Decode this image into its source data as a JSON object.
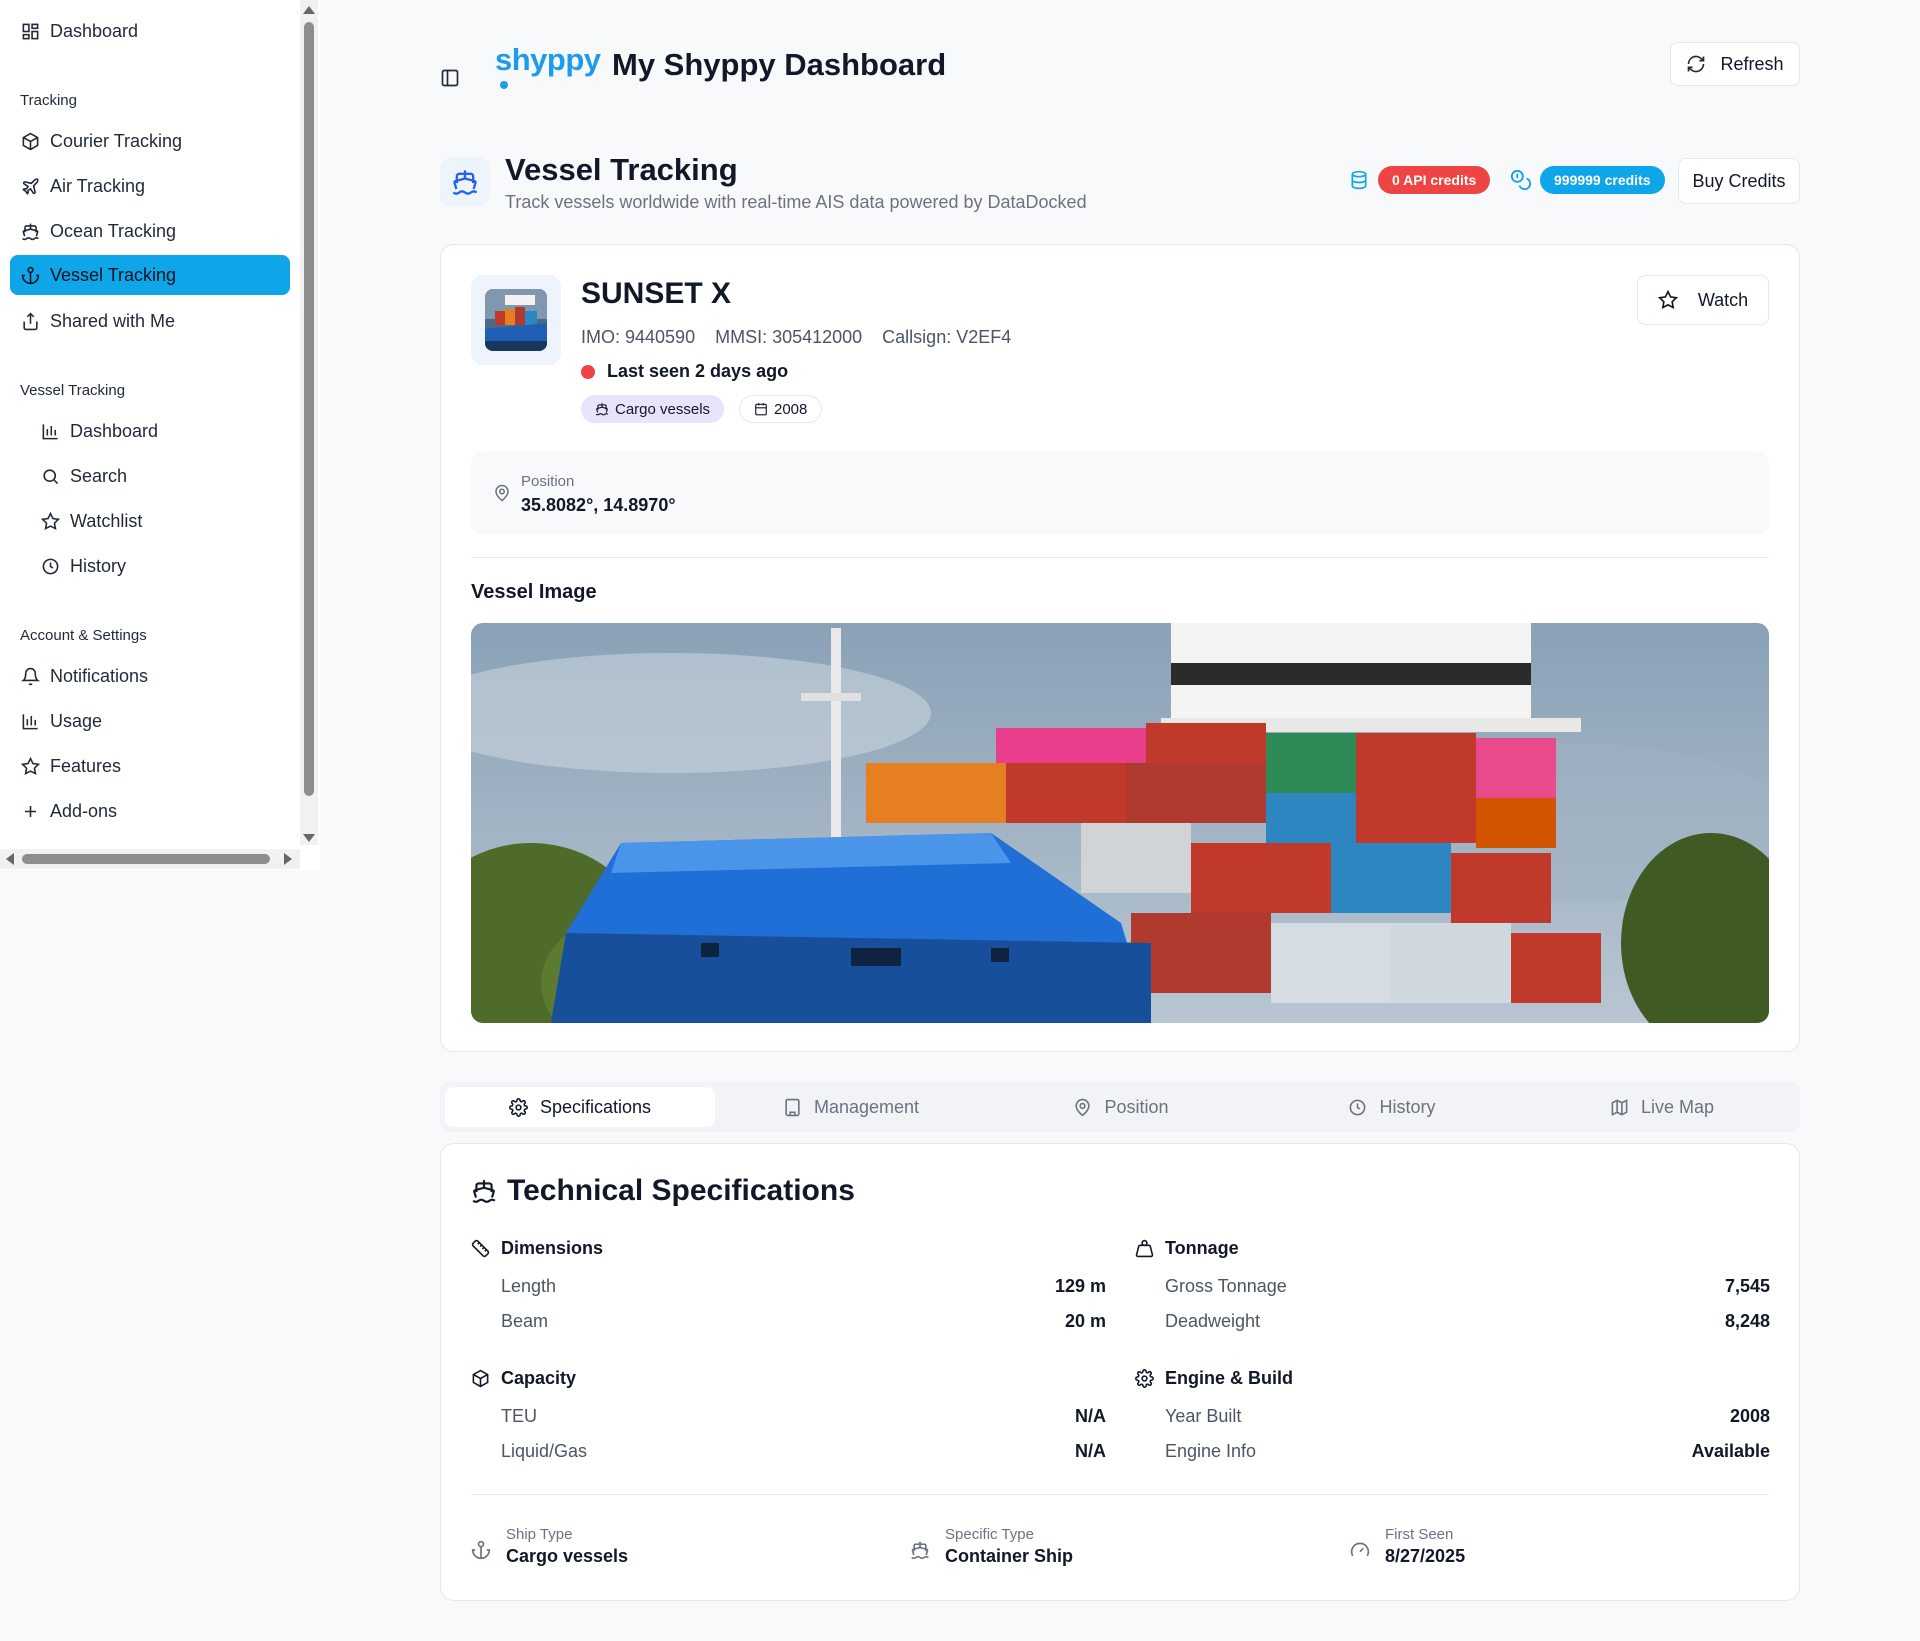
{
  "sidebar": {
    "top_item": "Dashboard",
    "sections": [
      {
        "title": "Tracking",
        "items": [
          "Courier Tracking",
          "Air Tracking",
          "Ocean Tracking",
          "Vessel Tracking",
          "Shared with Me"
        ]
      },
      {
        "title": "Vessel Tracking",
        "items": [
          "Dashboard",
          "Search",
          "Watchlist",
          "History"
        ]
      },
      {
        "title": "Account & Settings",
        "items": [
          "Notifications",
          "Usage",
          "Features",
          "Add-ons"
        ]
      }
    ],
    "active_item": "Vessel Tracking"
  },
  "header": {
    "logo": "shyppy",
    "title": "My Shyppy Dashboard",
    "refresh_label": "Refresh"
  },
  "page": {
    "title": "Vessel Tracking",
    "subtitle": "Track vessels worldwide with real-time AIS data powered by DataDocked",
    "api_credits": "0 API credits",
    "credits": "999999 credits",
    "buy_label": "Buy Credits"
  },
  "vessel": {
    "name": "SUNSET X",
    "imo": "IMO: 9440590",
    "mmsi": "MMSI: 305412000",
    "callsign": "Callsign: V2EF4",
    "last_seen": "Last seen 2 days ago",
    "type_tag": "Cargo vessels",
    "year_tag": "2008",
    "watch_label": "Watch",
    "position_label": "Position",
    "position_value": "35.8082°, 14.8970°",
    "image_label": "Vessel Image"
  },
  "tabs": [
    "Specifications",
    "Management",
    "Position",
    "History",
    "Live Map"
  ],
  "active_tab": "Specifications",
  "specs": {
    "title": "Technical Specifications",
    "dimensions": {
      "title": "Dimensions",
      "rows": [
        {
          "k": "Length",
          "v": "129 m"
        },
        {
          "k": "Beam",
          "v": "20 m"
        }
      ]
    },
    "tonnage": {
      "title": "Tonnage",
      "rows": [
        {
          "k": "Gross Tonnage",
          "v": "7,545"
        },
        {
          "k": "Deadweight",
          "v": "8,248"
        }
      ]
    },
    "capacity": {
      "title": "Capacity",
      "rows": [
        {
          "k": "TEU",
          "v": "N/A"
        },
        {
          "k": "Liquid/Gas",
          "v": "N/A"
        }
      ]
    },
    "engine": {
      "title": "Engine & Build",
      "rows": [
        {
          "k": "Year Built",
          "v": "2008"
        },
        {
          "k": "Engine Info",
          "v": "Available"
        }
      ]
    },
    "footer": [
      {
        "label": "Ship Type",
        "value": "Cargo vessels"
      },
      {
        "label": "Specific Type",
        "value": "Container Ship"
      },
      {
        "label": "First Seen",
        "value": "8/27/2025"
      }
    ]
  },
  "colors": {
    "accent": "#0ea5e9",
    "logo": "#1e9be9",
    "danger": "#ef4444",
    "tag_purple": "#e9e3fb"
  },
  "icons": [
    "grid-icon",
    "package-icon",
    "plane-icon",
    "ship-icon",
    "anchor-icon",
    "share-icon",
    "bar-chart-icon",
    "search-icon",
    "star-icon",
    "clock-icon",
    "bell-icon",
    "plus-icon",
    "sidebar-toggle-icon",
    "refresh-icon",
    "database-icon",
    "coins-icon",
    "calendar-icon",
    "map-pin-icon",
    "gear-icon",
    "building-icon",
    "map-icon",
    "ruler-icon",
    "weight-icon",
    "gauge-icon"
  ]
}
